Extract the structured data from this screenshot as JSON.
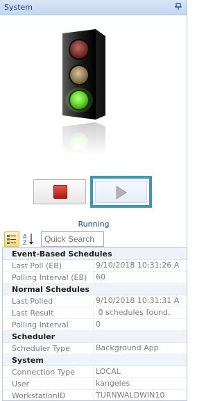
{
  "window": {
    "title": "System",
    "pin_icon": "pin-icon"
  },
  "status": "Running",
  "buttons": {
    "stop_icon": "stop-icon",
    "play_icon": "play-icon"
  },
  "toolbar": {
    "search_placeholder": "Quick Search"
  },
  "colors": {
    "accent_frame": "#3a98b9",
    "title_text": "#15428b",
    "light_green": "#6fe03a"
  },
  "properties": [
    {
      "category": "Event-Based Schedules",
      "rows": [
        {
          "name": "Last Poll (EB)",
          "value": "9/10/2018 10:31:26 A"
        },
        {
          "name": "Polling Interval (EB)",
          "value": "60"
        }
      ]
    },
    {
      "category": "Normal Schedules",
      "rows": [
        {
          "name": "Last Polled",
          "value": "9/10/2018 10:31:31 A"
        },
        {
          "name": "Last Result",
          "value": " 0 schedules found."
        },
        {
          "name": "Polling Interval",
          "value": "0"
        }
      ]
    },
    {
      "category": "Scheduler",
      "rows": [
        {
          "name": "Scheduler Type",
          "value": "Background App"
        }
      ]
    },
    {
      "category": "System",
      "rows": [
        {
          "name": "Connection Type",
          "value": "LOCAL"
        },
        {
          "name": "User",
          "value": "kangeles"
        },
        {
          "name": "WorkstationID",
          "value": "TURNWALDWIN10"
        }
      ]
    }
  ]
}
